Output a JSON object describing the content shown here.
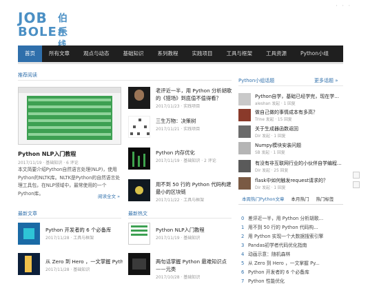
{
  "logo": {
    "line1": "JOB",
    "line2": "BOLE",
    "cn1": "伯乐",
    "cn2": "在线"
  },
  "nav": {
    "items": [
      "首页",
      "所有文章",
      "观点与动态",
      "基础知识",
      "系列教程",
      "实践项目",
      "工具与框架",
      "工具资源",
      "Python小组"
    ],
    "active_index": 0
  },
  "featured": {
    "section": "推荐阅读",
    "title": "Python NLP入门教程",
    "meta": "2017/11/19 · 基础知识 · 6 评论",
    "desc": "本文简要介绍Python自然语言处理(NLP)，使用Python的NLTK库。NLTK是Python的自然语言处理工具包，在NLP领域中，最常使用的一个Python库。",
    "read_more": "阅读全文 »"
  },
  "articles": [
    {
      "title": "老评近一半，用 Python 分析胡歌的《猎场》到底值不值得看？",
      "meta": "2017/11/23 · 实践项目"
    },
    {
      "title": "三生万物：决策树",
      "meta": "2017/11/21 · 实践项目"
    },
    {
      "title": "Python 内存优化",
      "meta": "2017/11/19 · 基础知识 · 2 评论"
    },
    {
      "title": "用不到 50 行的 Python 代码构建最小的区块链",
      "meta": "2017/11/22 · 工具与框架"
    }
  ],
  "latest": {
    "section": "最新文章",
    "items": [
      {
        "title": "Python 开发者的 6 个必备库",
        "meta": "2017/11/28 · 工具与框架"
      },
      {
        "title": "从 Zero 到 Hero ，一文掌握 Python",
        "meta": "2017/11/28 · 基础知识"
      }
    ]
  },
  "hot_new": {
    "section": "最新热文",
    "items": [
      {
        "title": "Python NLP入门教程",
        "meta": "2017/11/19 · 基础知识"
      },
      {
        "title": "两句话掌握 Python 最难知识点——元类",
        "meta": "2017/10/28 · 基础知识"
      }
    ]
  },
  "sidebar": {
    "section": "Python小组话题",
    "more": "更多话题 »",
    "topics": [
      {
        "title": "Python自学，基础已经学完，现在学...",
        "meta": "aleshan 发起 · 1 回复"
      },
      {
        "title": "做自己做的事情成本有多高？",
        "meta": "Trine 发起 · 15 回复"
      },
      {
        "title": "关于生成器函数返回",
        "meta": "Dir 发起 · 1 回复"
      },
      {
        "title": "Numpy模块安装问题",
        "meta": "SB 发起 · 1 回复"
      },
      {
        "title": "有没有非互联网行业的小伙伴自学编程...",
        "meta": "Dir 发起 · 25 回复"
      },
      {
        "title": "flask中如何触发request请求的？",
        "meta": "Dir 发起 · 1 回复"
      }
    ],
    "tabs": [
      "本周热门Python文章",
      "本月热门",
      "热门标签"
    ],
    "active_tab": 0,
    "hot": [
      {
        "num": "0",
        "title": "差评近一半，用 Python 分析胡歌..."
      },
      {
        "num": "1",
        "title": "用不到 50 行的 Python 代码构..."
      },
      {
        "num": "2",
        "title": "用 Python 实现一个大数据搜索引擎"
      },
      {
        "num": "3",
        "title": "Pandas初学者代码优化指南"
      },
      {
        "num": "4",
        "title": "动画示意：随机森林"
      },
      {
        "num": "5",
        "title": "从 Zero 到 Hero ，一文掌握 Py..."
      },
      {
        "num": "6",
        "title": "Python 开发者的 6 个必备库"
      },
      {
        "num": "7",
        "title": "Python 性能优化"
      }
    ]
  },
  "colors": {
    "nav_bg": "#1f1f1f",
    "accent": "#2f6fab"
  }
}
